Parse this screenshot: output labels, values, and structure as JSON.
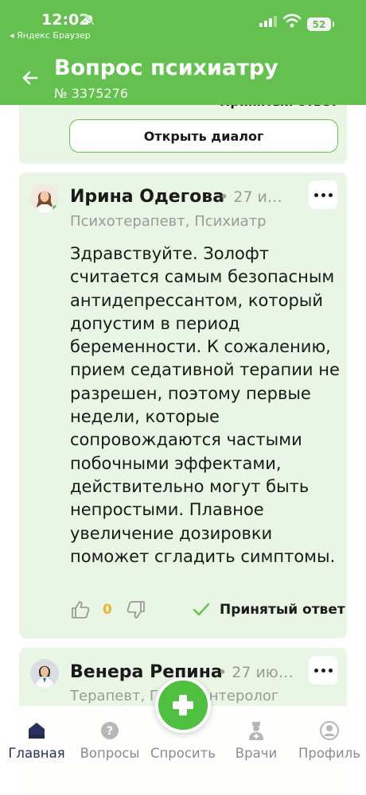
{
  "status": {
    "time": "12:02",
    "back_app": "◂ Яндекс Браузер",
    "battery": "52"
  },
  "header": {
    "title": "Вопрос психиатру",
    "subtitle": "№ 3375276"
  },
  "previous_answer": {
    "accepted_label": "Принятый ответ",
    "open_dialog_label": "Открыть диалог"
  },
  "answers": [
    {
      "name": "Ирина Одегова",
      "date": "• 27 и…",
      "specialty": "Психотерапевт, Психиатр",
      "text": "Здравствуйте. Золофт считается самым безопасным антидепрессантом, который допустим в период беременности. К сожалению, прием седативной терапии не разрешен, поэтому первые недели, которые сопровождаются частыми побочными эффектами, действительно могут быть непростыми. Плавное увеличение дозировки поможет сгладить симптомы.",
      "likes": "0",
      "accepted_label": "Принятый ответ"
    },
    {
      "name": "Венера Репина",
      "date": "• 27 ию…",
      "specialty": "Терапевт, Гастроэнтеролог"
    }
  ],
  "nav": {
    "items": [
      {
        "label": "Главная",
        "icon": "home-icon"
      },
      {
        "label": "Вопросы",
        "icon": "question-icon"
      },
      {
        "label": "Спросить",
        "icon": "plus-icon"
      },
      {
        "label": "Врачи",
        "icon": "doctor-icon"
      },
      {
        "label": "Профиль",
        "icon": "profile-icon"
      }
    ]
  },
  "colors": {
    "brand_green": "#64c04f",
    "card_bg": "#e9f6e5",
    "like_count": "#e9b233",
    "nav_active": "#28315b"
  }
}
